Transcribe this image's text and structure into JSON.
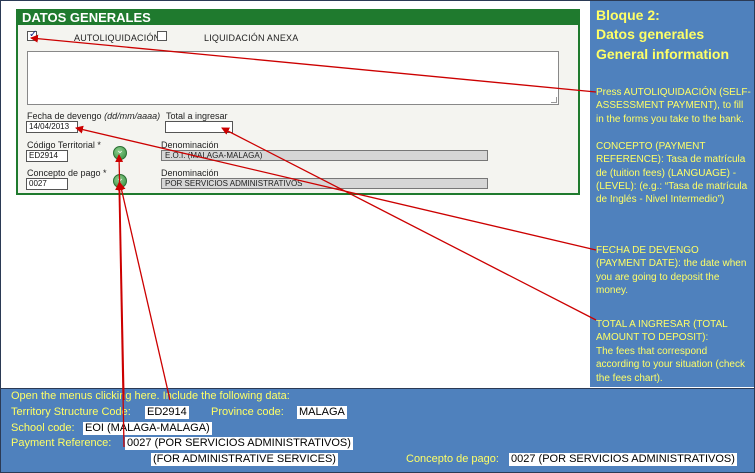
{
  "form": {
    "header": "DATOS GENERALES",
    "autoliquidacion_label": "AUTOLIQUIDACIÓN",
    "liquidacion_anexa_label": "LIQUIDACIÓN ANEXA",
    "fecha_label": "Fecha de devengo",
    "fecha_format": "(dd/mm/aaaa)",
    "fecha_value": "14/04/2013",
    "total_label": "Total a ingresar",
    "total_value": "",
    "codigo_label": "Código Territorial *",
    "codigo_value": "ED2914",
    "denominacion_label_1": "Denominación",
    "denominacion_value_1": "E.O.I. (MALAGA-MALAGA)",
    "concepto_label": "Concepto de pago *",
    "concepto_value": "0027",
    "denominacion_label_2": "Denominación",
    "denominacion_value_2": "POR SERVICIOS ADMINISTRATIVOS"
  },
  "info": {
    "title_1": "Bloque 2:",
    "title_2": "Datos generales",
    "title_3": "General information",
    "p1_a": "Press AUTOLIQUIDACIÓN (SELF-ASSESSMENT PAYMENT), to fill in the forms you take to the bank.",
    "p1_b": "CONCEPTO (PAYMENT REFERENCE): Tasa de matrícula de (tuition fees) (LANGUAGE) -(LEVEL): (e.g.: “Tasa de matrícula de Inglés - Nivel Intermedio”)",
    "p2": "FECHA DE DEVENGO (PAYMENT DATE): the date when you are going to deposit the money.",
    "p3_a": "TOTAL A INGRESAR (TOTAL AMOUNT TO DEPOSIT):",
    "p3_b": "The fees that correspond according to your situation (check the fees chart)."
  },
  "bottom": {
    "line1": "Open the menus clicking here. Include the following data:",
    "territory_label": "Territory Structure Code:",
    "territory_value": "ED2914",
    "province_label": "Province code:",
    "province_value": "MALAGA",
    "school_label": "School code:",
    "school_value": "EOI (MALAGA-MALAGA)",
    "payment_label": "Payment Reference:",
    "payment_value": "0027 (POR SERVICIOS ADMINISTRATIVOS)",
    "admin_value": "(FOR ADMINISTRATIVE SERVICES)",
    "concepto_label": "Concepto de pago:",
    "concepto_value": "0027 (POR SERVICIOS ADMINISTRATIVOS)"
  },
  "colors": {
    "form_green": "#1f7a2e",
    "panel_blue": "#4f81bd",
    "text_yellow": "#ffff66",
    "arrow_red": "#cc0000"
  }
}
